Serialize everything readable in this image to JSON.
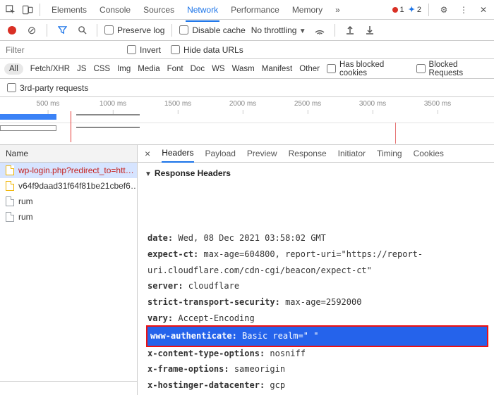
{
  "topbar": {
    "tabs": [
      "Elements",
      "Console",
      "Sources",
      "Network",
      "Performance",
      "Memory"
    ],
    "active_tab": "Network",
    "more": "»",
    "errors": "1",
    "messages": "2"
  },
  "toolbar": {
    "preserve_log": "Preserve log",
    "disable_cache": "Disable cache",
    "throttling": "No throttling"
  },
  "filterbar": {
    "placeholder": "Filter",
    "invert": "Invert",
    "hide_data_urls": "Hide data URLs"
  },
  "types": {
    "all": "All",
    "items": [
      "Fetch/XHR",
      "JS",
      "CSS",
      "Img",
      "Media",
      "Font",
      "Doc",
      "WS",
      "Wasm",
      "Manifest",
      "Other"
    ],
    "has_blocked_cookies": "Has blocked cookies",
    "blocked_requests": "Blocked Requests"
  },
  "thirdparty": {
    "label": "3rd-party requests"
  },
  "timeline": {
    "ticks": [
      "500 ms",
      "1000 ms",
      "1500 ms",
      "2000 ms",
      "2500 ms",
      "3000 ms",
      "3500 ms"
    ]
  },
  "requests": {
    "header": "Name",
    "items": [
      {
        "name": "wp-login.php?redirect_to=htt…",
        "kind": "doc",
        "selected": true,
        "error": true
      },
      {
        "name": "v64f9daad31f64f81be21cbef6…",
        "kind": "doc",
        "selected": false,
        "error": false
      },
      {
        "name": "rum",
        "kind": "gray",
        "selected": false,
        "error": false
      },
      {
        "name": "rum",
        "kind": "gray",
        "selected": false,
        "error": false
      }
    ]
  },
  "detail_tabs": {
    "items": [
      "Headers",
      "Payload",
      "Preview",
      "Response",
      "Initiator",
      "Timing",
      "Cookies"
    ],
    "active": "Headers"
  },
  "response_headers": {
    "title": "Response Headers",
    "lines": [
      {
        "k": "date:",
        "v": " Wed, 08 Dec 2021 03:58:02 GMT"
      },
      {
        "k": "expect-ct:",
        "v": " max-age=604800, report-uri=\"https://report-uri.cloudflare.com/cdn-cgi/beacon/expect-ct\""
      },
      {
        "k": "server:",
        "v": " cloudflare"
      },
      {
        "k": "strict-transport-security:",
        "v": " max-age=2592000"
      },
      {
        "k": "vary:",
        "v": " Accept-Encoding"
      },
      {
        "k": "www-authenticate:",
        "v": " Basic realm=\"                              \"",
        "highlight": true
      },
      {
        "k": "x-content-type-options:",
        "v": " nosniff"
      },
      {
        "k": "x-frame-options:",
        "v": " sameorigin"
      },
      {
        "k": "x-hostinger-datacenter:",
        "v": " gcp"
      }
    ]
  }
}
